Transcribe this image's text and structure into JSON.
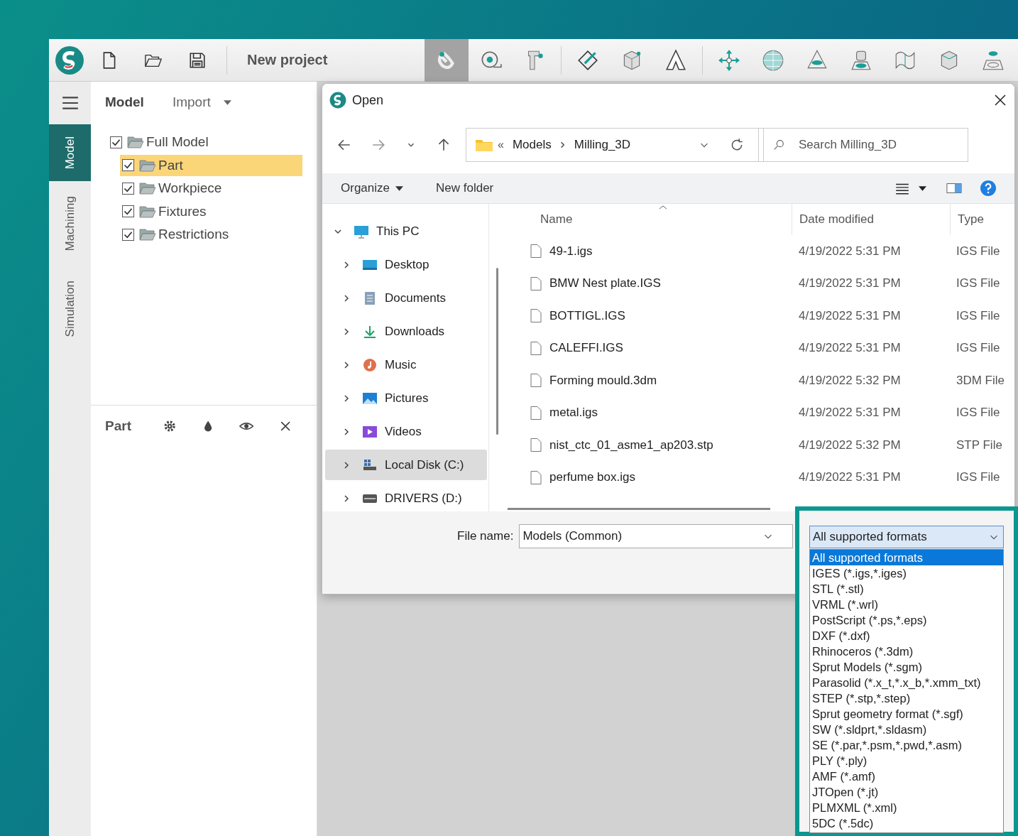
{
  "toolbar": {
    "project_title": "New project"
  },
  "side_tabs": [
    {
      "label": "Model",
      "selected": true
    },
    {
      "label": "Machining",
      "selected": false
    },
    {
      "label": "Simulation",
      "selected": false
    }
  ],
  "panel": {
    "tabs": [
      {
        "label": "Model",
        "selected": true
      },
      {
        "label": "Import",
        "selected": false
      }
    ],
    "tree": [
      {
        "label": "Full Model",
        "checked": true,
        "selected": false,
        "children": [
          {
            "label": "Part",
            "checked": true,
            "selected": true
          },
          {
            "label": "Workpiece",
            "checked": true,
            "selected": false
          },
          {
            "label": "Fixtures",
            "checked": true,
            "selected": false
          },
          {
            "label": "Restrictions",
            "checked": true,
            "selected": false
          }
        ]
      }
    ]
  },
  "properties": {
    "title": "Part"
  },
  "dialog": {
    "title": "Open",
    "breadcrumb_overflow": "«",
    "breadcrumb": [
      "Models",
      "Milling_3D"
    ],
    "search": {
      "placeholder": "Search Milling_3D"
    },
    "commands": [
      "Organize",
      "New folder"
    ],
    "nav": [
      {
        "label": "This PC",
        "kind": "pc",
        "expanded": true,
        "selected": false,
        "children": [
          {
            "label": "Desktop",
            "kind": "desktop",
            "expanded": false,
            "selected": false
          },
          {
            "label": "Documents",
            "kind": "documents",
            "expanded": false,
            "selected": false
          },
          {
            "label": "Downloads",
            "kind": "downloads",
            "expanded": false,
            "selected": false
          },
          {
            "label": "Music",
            "kind": "music",
            "expanded": false,
            "selected": false
          },
          {
            "label": "Pictures",
            "kind": "pictures",
            "expanded": false,
            "selected": false
          },
          {
            "label": "Videos",
            "kind": "videos",
            "expanded": false,
            "selected": false
          },
          {
            "label": "Local Disk (C:)",
            "kind": "disk",
            "expanded": false,
            "selected": true
          },
          {
            "label": "DRIVERS (D:)",
            "kind": "drive",
            "expanded": false,
            "selected": false
          }
        ]
      }
    ],
    "columns": [
      "Name",
      "Date modified",
      "Type"
    ],
    "files": [
      {
        "name": "49-1.igs",
        "date": "4/19/2022 5:31 PM",
        "type": "IGS File"
      },
      {
        "name": "BMW Nest plate.IGS",
        "date": "4/19/2022 5:31 PM",
        "type": "IGS File"
      },
      {
        "name": "BOTTIGL.IGS",
        "date": "4/19/2022 5:31 PM",
        "type": "IGS File"
      },
      {
        "name": "CALEFFI.IGS",
        "date": "4/19/2022 5:31 PM",
        "type": "IGS File"
      },
      {
        "name": "Forming mould.3dm",
        "date": "4/19/2022 5:32 PM",
        "type": "3DM File"
      },
      {
        "name": "metal.igs",
        "date": "4/19/2022 5:31 PM",
        "type": "IGS File"
      },
      {
        "name": "nist_ctc_01_asme1_ap203.stp",
        "date": "4/19/2022 5:32 PM",
        "type": "STP File"
      },
      {
        "name": "perfume box.igs",
        "date": "4/19/2022 5:31 PM",
        "type": "IGS File"
      }
    ],
    "file_name": {
      "label": "File name:",
      "value": "Models (Common)"
    },
    "filter": {
      "value": "All supported formats",
      "expanded": true,
      "options": [
        {
          "label": "All supported formats",
          "selected": true
        },
        {
          "label": "IGES (*.igs,*.iges)",
          "selected": false
        },
        {
          "label": "STL (*.stl)",
          "selected": false
        },
        {
          "label": "VRML (*.wrl)",
          "selected": false
        },
        {
          "label": "PostScript (*.ps,*.eps)",
          "selected": false
        },
        {
          "label": "DXF (*.dxf)",
          "selected": false
        },
        {
          "label": "Rhinoceros (*.3dm)",
          "selected": false
        },
        {
          "label": "Sprut Models (*.sgm)",
          "selected": false
        },
        {
          "label": "Parasolid (*.x_t,*.x_b,*.xmm_txt)",
          "selected": false
        },
        {
          "label": "STEP (*.stp,*.step)",
          "selected": false
        },
        {
          "label": "Sprut geometry format (*.sgf)",
          "selected": false
        },
        {
          "label": "SW (*.sldprt,*.sldasm)",
          "selected": false
        },
        {
          "label": "SE (*.par,*.psm,*.pwd,*.asm)",
          "selected": false
        },
        {
          "label": "PLY (*.ply)",
          "selected": false
        },
        {
          "label": "AMF (*.amf)",
          "selected": false
        },
        {
          "label": "JTOpen (*.jt)",
          "selected": false
        },
        {
          "label": "PLMXML (*.xml)",
          "selected": false
        },
        {
          "label": "5DC (*.5dc)",
          "selected": false
        }
      ]
    }
  }
}
